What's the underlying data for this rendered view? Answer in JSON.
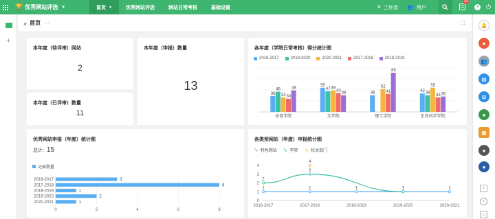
{
  "header": {
    "app_title": "优秀网站评选",
    "nav": [
      "首页",
      "优秀网站评选",
      "网站日常考核",
      "基础设置"
    ],
    "workbench": "工作流",
    "user": "用户",
    "msg_count": "33"
  },
  "breadcrumb": {
    "title": "首页",
    "more": "···"
  },
  "cards": {
    "pending_title": "本年度（待评审）网站",
    "pending_value": "2",
    "reviewed_title": "本年度（已评审）数量",
    "reviewed_value": "11",
    "declared_title": "本年度（申报）数量",
    "declared_value": "13"
  },
  "colors": {
    "accent": "#3fb66f",
    "series": [
      "#5aaef2",
      "#3cc0a6",
      "#f5b53f",
      "#ef6b6b",
      "#9b6fd6"
    ]
  },
  "chart_data": [
    {
      "type": "bar",
      "title": "各年度（学院日常考核）得分统计图",
      "categories": [
        "体育学院",
        "文学院",
        "理工学院",
        "生命科学学院"
      ],
      "series": [
        {
          "name": "2016-2017",
          "values": [
            36,
            55,
            38,
            42
          ]
        },
        {
          "name": "2019-2020",
          "values": [
            46,
            47,
            null,
            38
          ]
        },
        {
          "name": "2020-2021",
          "values": [
            33,
            49,
            52,
            55
          ]
        },
        {
          "name": "2017-2018",
          "values": [
            30,
            43,
            41,
            33
          ]
        },
        {
          "name": "2018-2019",
          "values": [
            49,
            38,
            89,
            35
          ]
        }
      ],
      "ylim": [
        0,
        100
      ],
      "grid": true,
      "legend": "top"
    },
    {
      "type": "bar",
      "orientation": "horizontal",
      "title": "优秀网站申报（年度）统计图",
      "total_label": "总计:",
      "total": "15",
      "categories": [
        "2016-2017",
        "2017-2018",
        "2018-2019",
        "2019-2020",
        "2020-2021"
      ],
      "series": [
        {
          "name": "记录数量",
          "values": [
            3,
            8,
            1,
            2,
            1
          ]
        }
      ],
      "xlim": [
        0,
        8
      ],
      "xticks": [
        "0",
        "2",
        "4",
        "6",
        "8"
      ],
      "legend": "top-left"
    },
    {
      "type": "line",
      "title": "各类型网站（年度）申报统计图",
      "categories": [
        "2016-2017",
        "2017-2018",
        "2018-2019",
        "2019-2020",
        "2020-2021"
      ],
      "series": [
        {
          "name": "特色网站",
          "values": [
            1,
            1,
            1,
            1,
            1
          ]
        },
        {
          "name": "学院",
          "values": [
            2,
            3,
            null,
            1,
            null
          ]
        },
        {
          "name": "机关部门",
          "values": [
            null,
            4,
            null,
            null,
            null
          ]
        }
      ],
      "ylim": [
        0,
        4
      ],
      "yticks": [
        "0",
        "1",
        "2",
        "3",
        "4"
      ],
      "legend": "top-left"
    }
  ]
}
